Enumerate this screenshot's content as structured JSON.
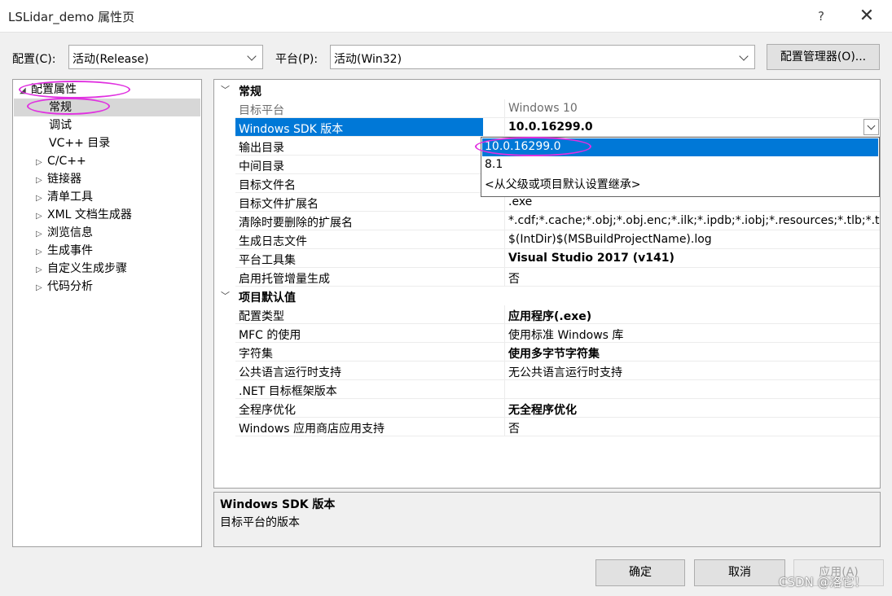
{
  "window": {
    "title": "LSLidar_demo 属性页",
    "help": "?",
    "close": "✕"
  },
  "toolbar": {
    "config_label": "配置(C):",
    "config_value": "活动(Release)",
    "platform_label": "平台(P):",
    "platform_value": "活动(Win32)",
    "config_manager": "配置管理器(O)..."
  },
  "tree": {
    "root": "配置属性",
    "items": [
      {
        "label": "常规",
        "expandable": false
      },
      {
        "label": "调试",
        "expandable": false
      },
      {
        "label": "VC++ 目录",
        "expandable": false
      },
      {
        "label": "C/C++",
        "expandable": true
      },
      {
        "label": "链接器",
        "expandable": true
      },
      {
        "label": "清单工具",
        "expandable": true
      },
      {
        "label": "XML 文档生成器",
        "expandable": true
      },
      {
        "label": "浏览信息",
        "expandable": true
      },
      {
        "label": "生成事件",
        "expandable": true
      },
      {
        "label": "自定义生成步骤",
        "expandable": true
      },
      {
        "label": "代码分析",
        "expandable": true
      }
    ]
  },
  "grid": {
    "general": {
      "title": "常规",
      "rows": [
        {
          "name": "目标平台",
          "value": "Windows 10"
        },
        {
          "name": "Windows SDK 版本",
          "value": "10.0.16299.0"
        },
        {
          "name": "输出目录",
          "value": ""
        },
        {
          "name": "中间目录",
          "value": ""
        },
        {
          "name": "目标文件名",
          "value": ""
        },
        {
          "name": "目标文件扩展名",
          "value": ".exe"
        },
        {
          "name": "清除时要删除的扩展名",
          "value": "*.cdf;*.cache;*.obj;*.obj.enc;*.ilk;*.ipdb;*.iobj;*.resources;*.tlb;*.tli;*"
        },
        {
          "name": "生成日志文件",
          "value": "$(IntDir)$(MSBuildProjectName).log"
        },
        {
          "name": "平台工具集",
          "value": "Visual Studio 2017 (v141)"
        },
        {
          "name": "启用托管增量生成",
          "value": "否"
        }
      ]
    },
    "defaults": {
      "title": "项目默认值",
      "rows": [
        {
          "name": "配置类型",
          "value": "应用程序(.exe)"
        },
        {
          "name": "MFC 的使用",
          "value": "使用标准 Windows 库"
        },
        {
          "name": "字符集",
          "value": "使用多字节字符集"
        },
        {
          "name": "公共语言运行时支持",
          "value": "无公共语言运行时支持"
        },
        {
          "name": ".NET 目标框架版本",
          "value": ""
        },
        {
          "name": "全程序优化",
          "value": "无全程序优化"
        },
        {
          "name": "Windows 应用商店应用支持",
          "value": "否"
        }
      ]
    }
  },
  "dropdown": {
    "options": [
      "10.0.16299.0",
      "8.1",
      "<从父级或项目默认设置继承>"
    ],
    "selected_index": 0
  },
  "description": {
    "title": "Windows SDK 版本",
    "text": "目标平台的版本"
  },
  "buttons": {
    "ok": "确定",
    "cancel": "取消",
    "apply": "应用(A)"
  },
  "watermark": "CSDN @洛它！",
  "colors": {
    "selection": "#0078d7",
    "annotation": "#e030e0"
  }
}
